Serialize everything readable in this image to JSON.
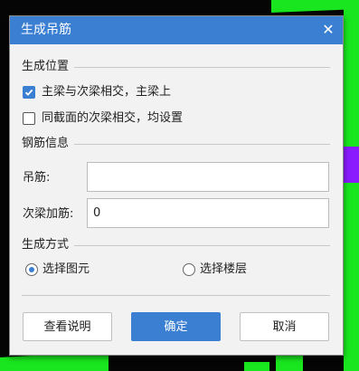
{
  "dialog": {
    "title": "生成吊筋",
    "close_glyph": "✕"
  },
  "position_section": {
    "title": "生成位置",
    "option_main": "主梁与次梁相交，主梁上",
    "option_main_checked": true,
    "option_same_section": "同截面的次梁相交，均设置",
    "option_same_section_checked": false
  },
  "rebar_section": {
    "title": "钢筋信息",
    "hanger_label": "吊筋:",
    "hanger_value": "",
    "secondary_label": "次梁加筋:",
    "secondary_value": "0"
  },
  "method_section": {
    "title": "生成方式",
    "option_select_element": "选择图元",
    "option_select_floor": "选择楼层",
    "selected": "选择图元"
  },
  "buttons": {
    "help": "查看说明",
    "ok": "确定",
    "cancel": "取消"
  },
  "colors": {
    "accent": "#3b7fd3",
    "background_lines": "#19e61e",
    "background_highlight": "#8a1bff"
  }
}
